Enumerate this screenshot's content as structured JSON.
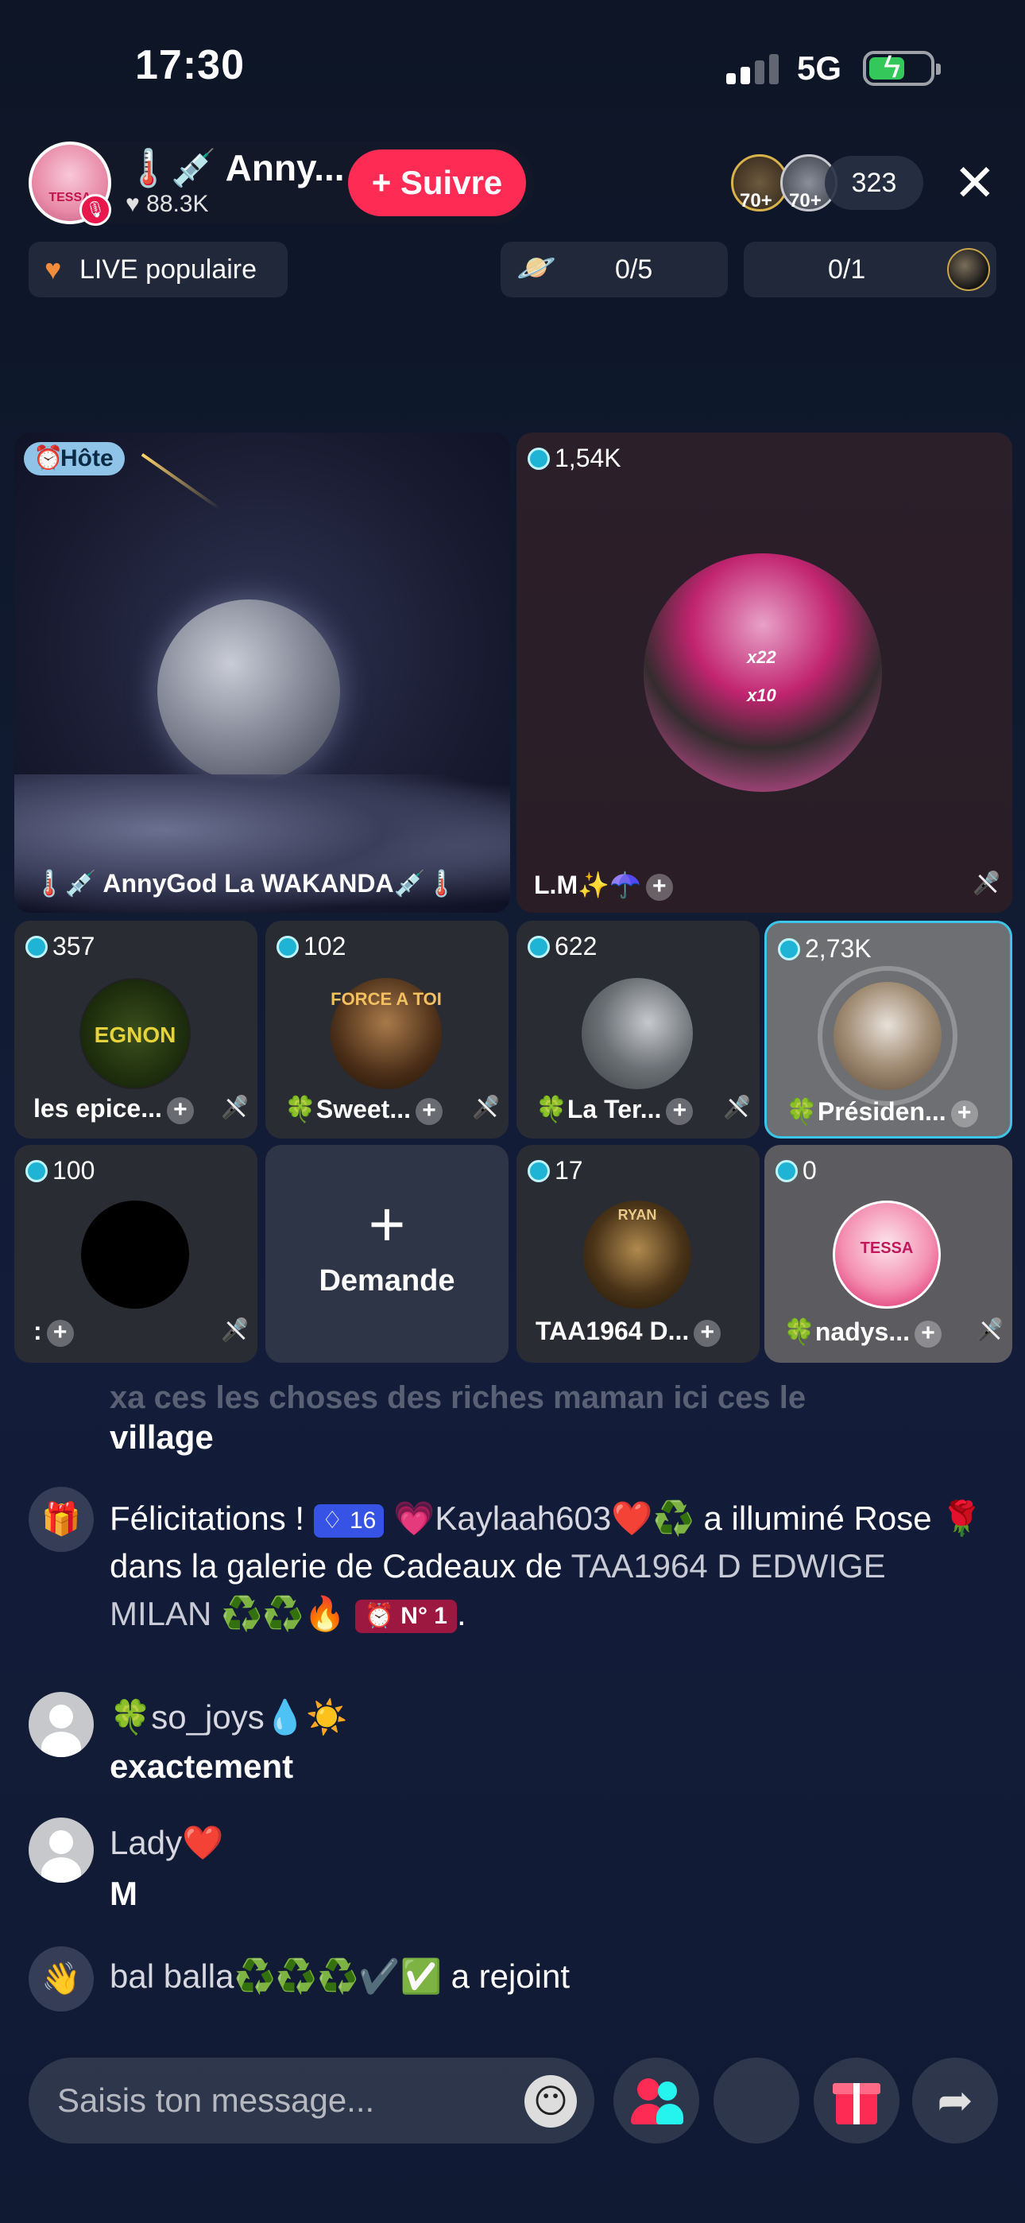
{
  "status_bar": {
    "time": "17:30",
    "network": "5G"
  },
  "header": {
    "host_name": "🌡️💉 Anny...",
    "likes": "♥ 88.3K",
    "follow_label": "+ Suivre",
    "avatar_text": "TESSA",
    "viewer_badges": [
      "70+",
      "70+"
    ],
    "viewer_count": "323",
    "close": "✕"
  },
  "badges": {
    "popular": "LIVE populaire",
    "goal1": "0/5",
    "goal2": "0/1"
  },
  "grid": {
    "host": {
      "badge": "Hôte",
      "name": "🌡️💉 AnnyGod La WAKANDA💉🌡️"
    },
    "guest1": {
      "count": "1,54K",
      "name": "L.M✨☂️",
      "overlay1": "x22",
      "overlay2": "x10"
    },
    "small": [
      {
        "count": "357",
        "name": "les epice...",
        "img_text": "EGNON"
      },
      {
        "count": "102",
        "name": "🍀Sweet...",
        "img_text": "FORCE A TOI"
      },
      {
        "count": "622",
        "name": "🍀La Ter..."
      },
      {
        "count": "2,73K",
        "name": "🍀Présiden..."
      },
      {
        "count": "100",
        "name": ":"
      },
      {
        "request": "Demande"
      },
      {
        "count": "17",
        "name": "TAA1964 D...",
        "img_text": "RYAN"
      },
      {
        "count": "0",
        "name": "🍀nadys...",
        "img_text": "TESSA"
      }
    ]
  },
  "chat": {
    "faded": "xa ces les choses des riches maman ici ces le",
    "line_village": "village",
    "gift_msg": {
      "prefix": "Félicitations ! ",
      "level": "♢ 16",
      "user": " 💗Kaylaah603❤️♻️",
      "rest": " a illuminé Rose 🌹 dans la galerie de Cadeaux de ",
      "target": "TAA1964 D EDWIGE MILAN ♻️♻️🔥",
      "rank": "⏰ N° 1",
      "end": "."
    },
    "messages": [
      {
        "user": "🍀so_joys💧☀️",
        "text": "exactement"
      },
      {
        "user": "Lady❤️",
        "text": "M"
      }
    ],
    "join": {
      "user": "bal balla♻️♻️♻️✔️✅",
      "text": " a rejoint"
    }
  },
  "bottom": {
    "placeholder": "Saisis ton message...",
    "emoji": "😶",
    "share": "➦"
  }
}
